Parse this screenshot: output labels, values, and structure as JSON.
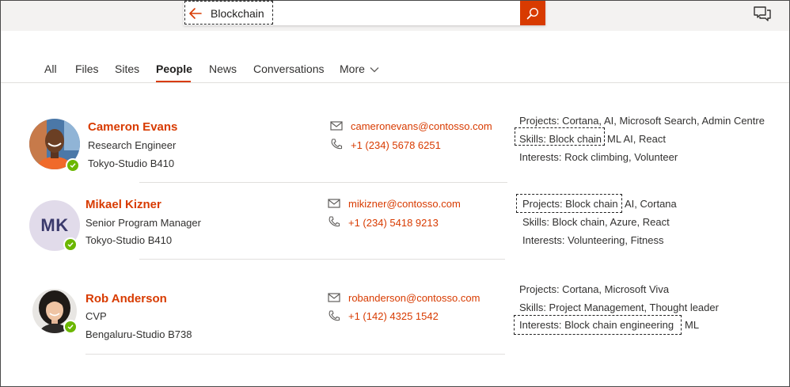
{
  "search": {
    "query": "Blockchain"
  },
  "tabs": [
    {
      "label": "All"
    },
    {
      "label": "Files"
    },
    {
      "label": "Sites"
    },
    {
      "label": "People"
    },
    {
      "label": "News"
    },
    {
      "label": "Conversations"
    },
    {
      "label": "More"
    }
  ],
  "people": [
    {
      "name": "Cameron Evans",
      "title": "Research Engineer",
      "location": "Tokyo-Studio B410",
      "email": "cameronevans@contosso.com",
      "phone": "+1 (234) 5678 6251",
      "projects": "Projects: Cortana, AI, Microsoft Search, Admin Centre",
      "skills_hl": "Skills: Block chain",
      "skills_rest": "ML AI, React",
      "interests": "Interests: Rock climbing, Volunteer"
    },
    {
      "initials": "MK",
      "name": "Mikael Kizner",
      "title": "Senior Program Manager",
      "location": "Tokyo-Studio B410",
      "email": "mikizner@contosso.com",
      "phone": "+1 (234) 5418 9213",
      "projects_hl": "Projects: Block chain",
      "projects_rest": "AI, Cortana",
      "skills": "Skills: Block chain, Azure, React",
      "interests": "Interests: Volunteering, Fitness"
    },
    {
      "name": "Rob Anderson",
      "title": "CVP",
      "location": "Bengaluru-Studio B738",
      "email": "robanderson@contosso.com",
      "phone": "+1 (142) 4325 1542",
      "projects": "Projects: Cortana, Microsoft Viva",
      "skills": "Skills: Project Management, Thought leader",
      "interests_hl": "Interests: Block chain engineering",
      "interests_rest": "ML"
    }
  ]
}
